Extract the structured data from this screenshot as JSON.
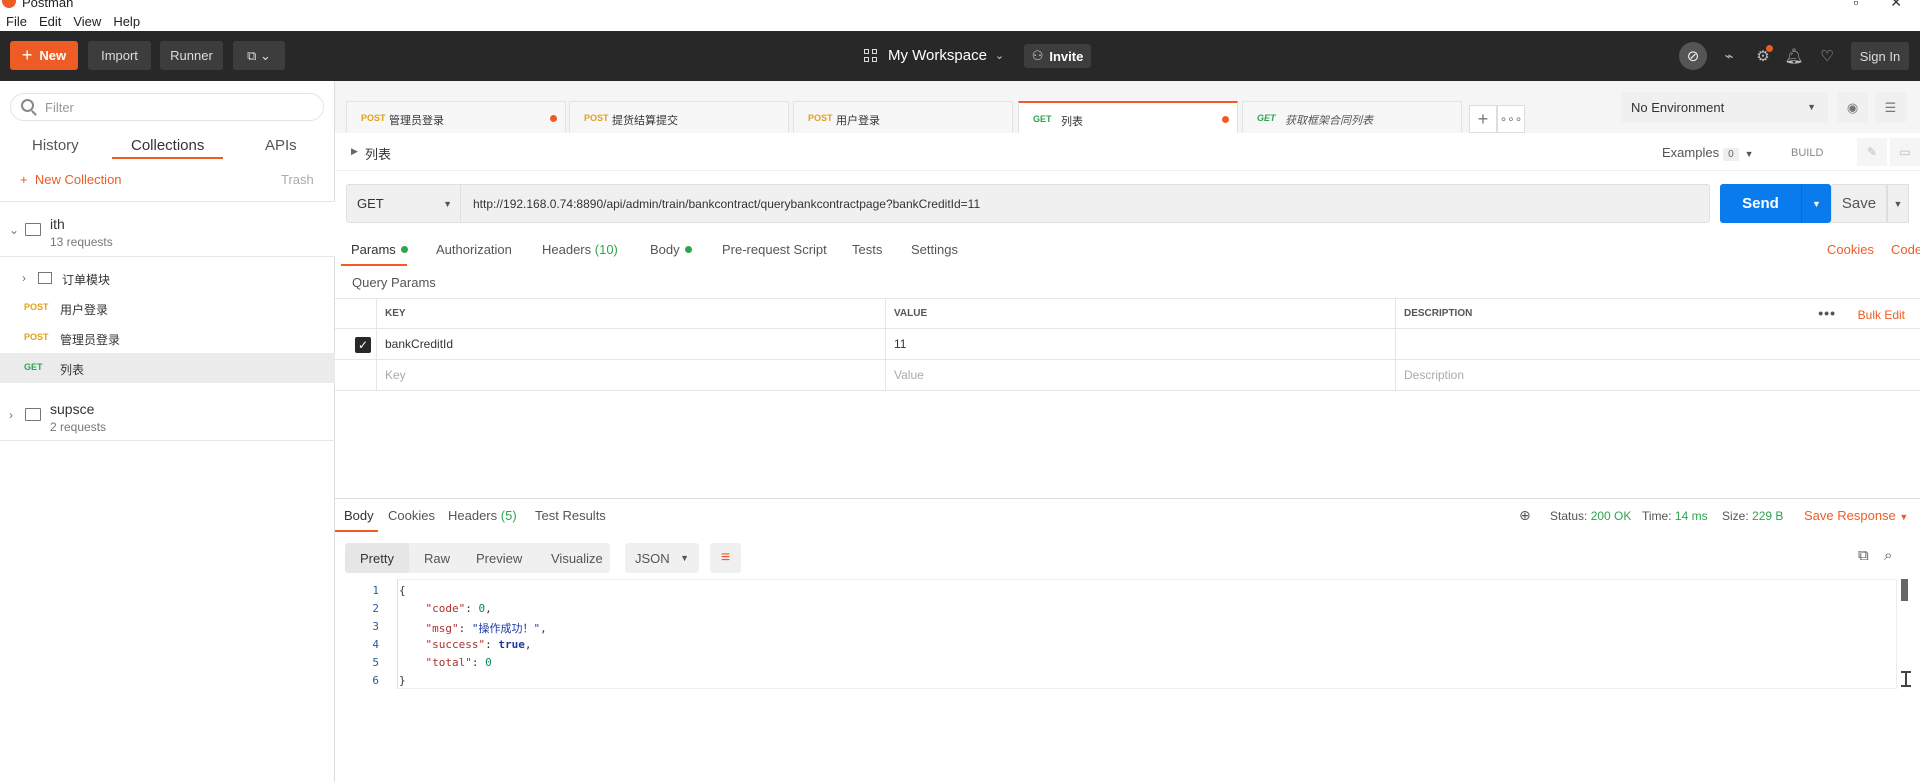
{
  "window": {
    "title": "Postman"
  },
  "menu": [
    "File",
    "Edit",
    "View",
    "Help"
  ],
  "header": {
    "new_label": "New",
    "import_label": "Import",
    "runner_label": "Runner",
    "workspace_label": "My Workspace",
    "invite_label": "Invite",
    "signin_label": "Sign In"
  },
  "sidebar": {
    "filter_placeholder": "Filter",
    "tabs": [
      "History",
      "Collections",
      "APIs"
    ],
    "new_collection_label": "New Collection",
    "trash_label": "Trash",
    "collections": [
      {
        "name": "ith",
        "sub": "13 requests",
        "folder": "订单模块",
        "requests": [
          {
            "method": "POST",
            "name": "用户登录"
          },
          {
            "method": "POST",
            "name": "管理员登录"
          },
          {
            "method": "GET",
            "name": "列表"
          }
        ]
      },
      {
        "name": "supsce",
        "sub": "2 requests"
      }
    ]
  },
  "tabs": [
    {
      "method": "POST",
      "name": "管理员登录"
    },
    {
      "method": "POST",
      "name": "提货结算提交"
    },
    {
      "method": "POST",
      "name": "用户登录"
    },
    {
      "method": "GET",
      "name": "列表"
    },
    {
      "method": "GET",
      "name": "获取框架合同列表"
    }
  ],
  "environment": {
    "selected": "No Environment"
  },
  "request": {
    "name": "列表",
    "examples_label": "Examples",
    "examples_count": "0",
    "build_label": "BUILD",
    "method": "GET",
    "url": "http://192.168.0.74:8890/api/admin/train/bankcontract/querybankcontractpage?bankCreditId=11",
    "send_label": "Send",
    "save_label": "Save",
    "tabs": {
      "params": "Params",
      "authorization": "Authorization",
      "headers": "Headers",
      "headers_count": "(10)",
      "body": "Body",
      "prerequest": "Pre-request Script",
      "tests": "Tests",
      "settings": "Settings"
    },
    "cookies_link": "Cookies",
    "code_link": "Code",
    "query_params_title": "Query Params",
    "columns": {
      "key": "KEY",
      "value": "VALUE",
      "description": "DESCRIPTION"
    },
    "bulk_edit_label": "Bulk Edit",
    "param": {
      "key": "bankCreditId",
      "value": "11"
    },
    "placeholders": {
      "key": "Key",
      "value": "Value",
      "description": "Description"
    }
  },
  "response": {
    "tabs": {
      "body": "Body",
      "cookies": "Cookies",
      "headers": "Headers",
      "headers_count": "(5)",
      "tests": "Test Results"
    },
    "status_label": "Status:",
    "status_value": "200 OK",
    "time_label": "Time:",
    "time_value": "14 ms",
    "size_label": "Size:",
    "size_value": "229 B",
    "save_label": "Save Response",
    "views": [
      "Pretty",
      "Raw",
      "Preview",
      "Visualize"
    ],
    "format": "JSON",
    "line_numbers": [
      "1",
      "2",
      "3",
      "4",
      "5",
      "6"
    ],
    "json": {
      "open": "{",
      "code_key": "\"code\"",
      "code_val": "0",
      "msg_key": "\"msg\"",
      "msg_val": "\"操作成功！\"",
      "success_key": "\"success\"",
      "success_val": "true",
      "total_key": "\"total\"",
      "total_val": "0",
      "close": "}"
    }
  }
}
